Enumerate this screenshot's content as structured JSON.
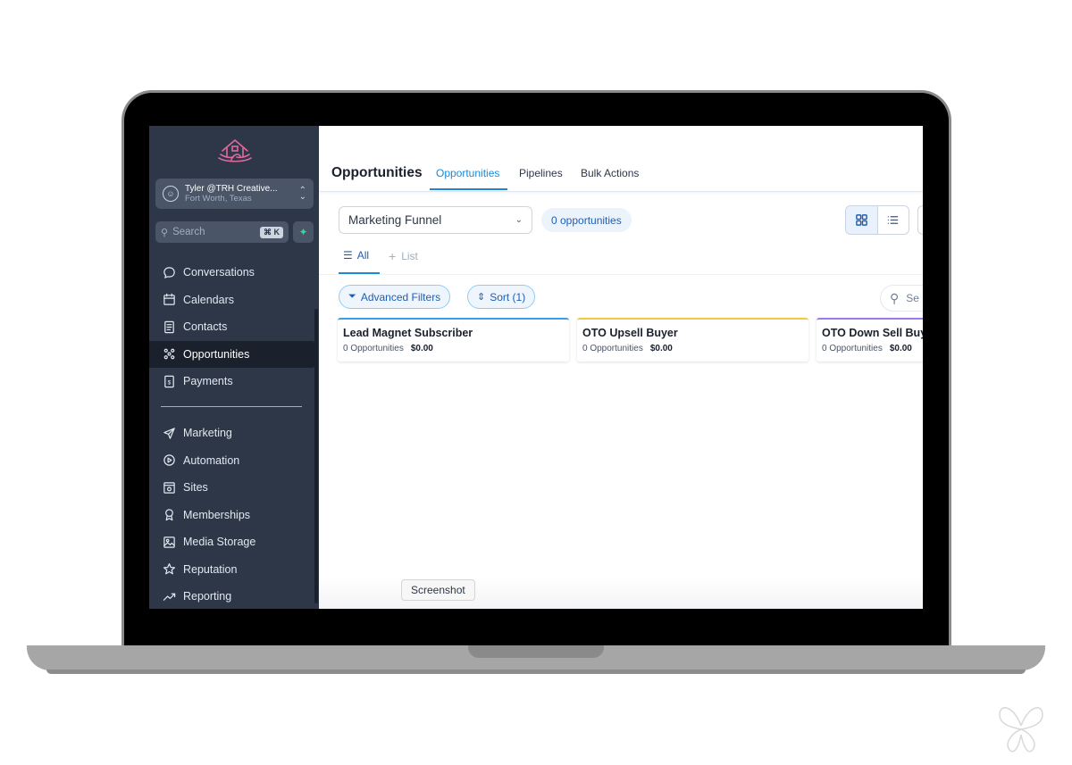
{
  "account": {
    "name": "Tyler @TRH Creative...",
    "location": "Fort Worth, Texas"
  },
  "search": {
    "placeholder": "Search",
    "shortcut": "⌘ K"
  },
  "nav_primary": [
    {
      "label": "Conversations",
      "icon": "chat-bubble-icon"
    },
    {
      "label": "Calendars",
      "icon": "calendar-icon"
    },
    {
      "label": "Contacts",
      "icon": "contacts-icon"
    },
    {
      "label": "Opportunities",
      "icon": "opportunities-icon",
      "active": true
    },
    {
      "label": "Payments",
      "icon": "payments-icon"
    }
  ],
  "nav_secondary": [
    {
      "label": "Marketing",
      "icon": "send-icon"
    },
    {
      "label": "Automation",
      "icon": "automation-icon"
    },
    {
      "label": "Sites",
      "icon": "sites-icon"
    },
    {
      "label": "Memberships",
      "icon": "memberships-icon"
    },
    {
      "label": "Media Storage",
      "icon": "image-icon"
    },
    {
      "label": "Reputation",
      "icon": "star-icon"
    },
    {
      "label": "Reporting",
      "icon": "trend-icon"
    }
  ],
  "header": {
    "title": "Opportunities",
    "tabs": [
      "Opportunities",
      "Pipelines",
      "Bulk Actions"
    ]
  },
  "toolbar": {
    "pipeline": "Marketing Funnel",
    "count": "0 opportunities",
    "view_modes": [
      "grid-view-icon",
      "list-view-icon"
    ]
  },
  "subtabs": {
    "all": "All",
    "add_list": "List"
  },
  "filters": {
    "advanced": "Advanced Filters",
    "sort": "Sort (1)",
    "search_stub": "Se"
  },
  "stages": [
    {
      "name": "Lead Magnet Subscriber",
      "count": "0 Opportunities",
      "amount": "$0.00",
      "color": "#3b9ee8"
    },
    {
      "name": "OTO Upsell Buyer",
      "count": "0 Opportunities",
      "amount": "$0.00",
      "color": "#f6c744"
    },
    {
      "name": "OTO Down Sell Buyer",
      "count": "0 Opportunities",
      "amount": "$0.00",
      "color": "#9f7aea"
    }
  ],
  "tooltip": "Screenshot",
  "colors": {
    "sidebar": "#2d3748",
    "accent": "#1a8ad8",
    "brand_pink": "#e26a9f"
  }
}
